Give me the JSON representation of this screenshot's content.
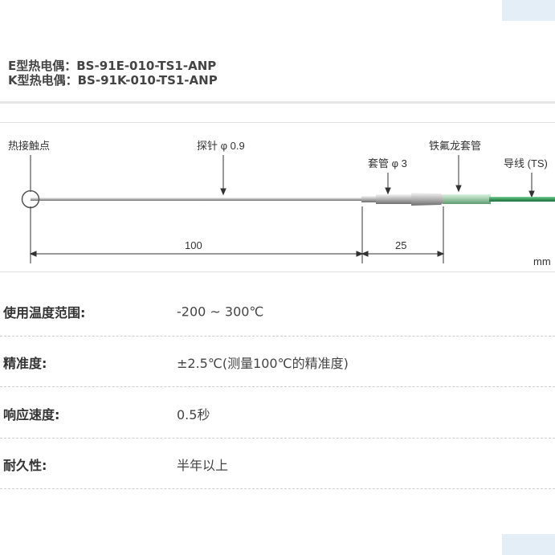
{
  "title": {
    "line1": "E型热电偶：BS-91E-010-TS1-ANP",
    "line2": "K型热电偶：BS-91K-010-TS1-ANP"
  },
  "diagram": {
    "labels": {
      "junction": "热接触点",
      "probe": "探针 φ 0.9",
      "sleeve": "套管 φ 3",
      "ptfe": "铁氟龙套管",
      "lead": "导线 (TS)"
    },
    "dims": {
      "probe_length": "100",
      "sleeve_length": "25",
      "unit": "mm"
    },
    "colors": {
      "lead_wire": "#3a9a5e",
      "line": "#333333"
    }
  },
  "specs": [
    {
      "label": "使用温度范围:",
      "value": "-200 ~ 300℃"
    },
    {
      "label": "精准度:",
      "value": "±2.5℃(测量100℃的精准度)"
    },
    {
      "label": "响应速度:",
      "value": "0.5秒"
    },
    {
      "label": "耐久性:",
      "value": "半年以上"
    }
  ]
}
